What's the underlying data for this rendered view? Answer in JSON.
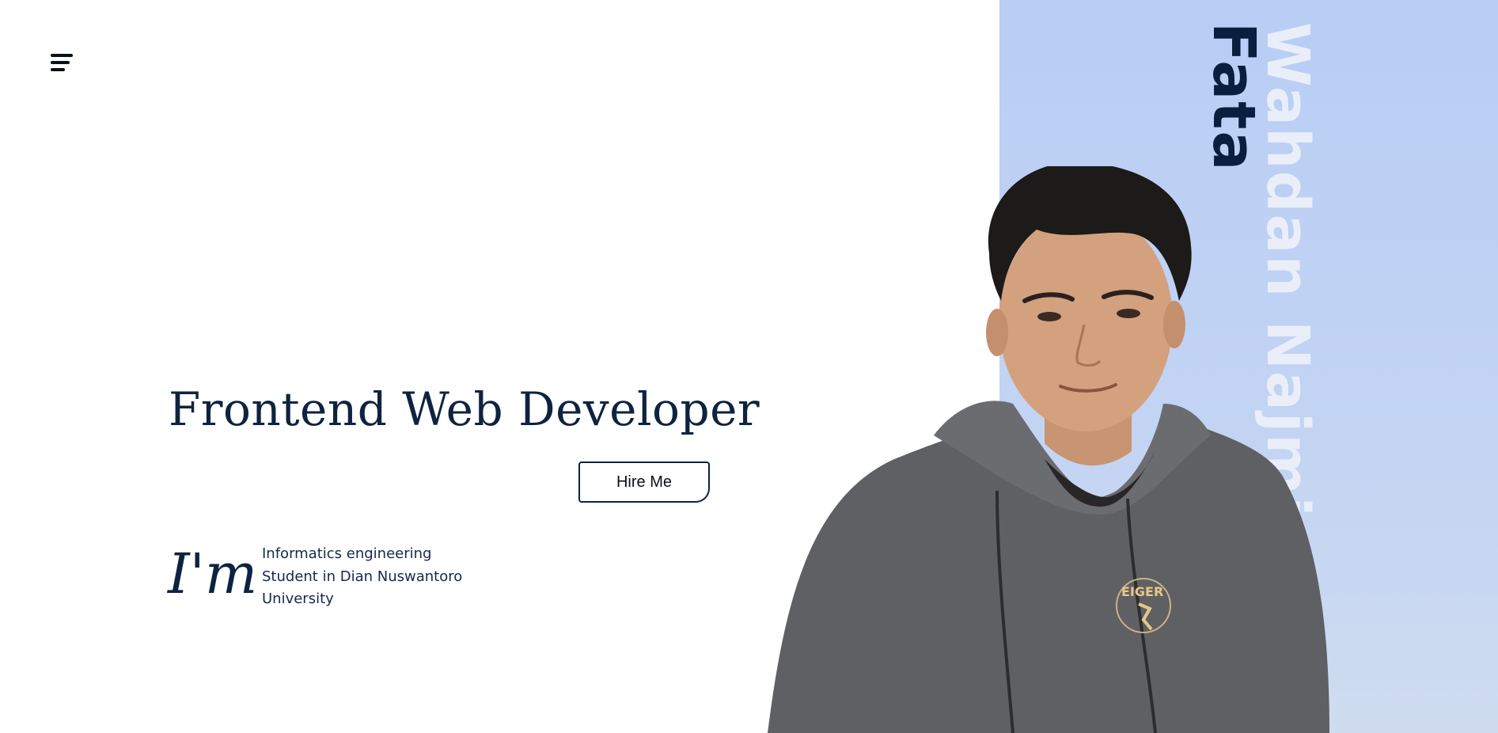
{
  "nav": {
    "menu_icon": "hamburger-menu-icon"
  },
  "hero": {
    "headline": "Frontend Web Developer",
    "hire_label": "Hire Me",
    "im_label": "I'm",
    "bio_lines": [
      "Informatics engineering",
      "Student in Dian Nuswantoro",
      "University"
    ]
  },
  "name": {
    "first": "Fata",
    "last": "Wahdan Najmi"
  },
  "portrait": {
    "shirt_brand": "EIGER"
  },
  "colors": {
    "primary_navy": "#0e2340",
    "panel_blue": "#b9cdf5",
    "name_light": "#e9eef8",
    "background": "#ffffff"
  }
}
